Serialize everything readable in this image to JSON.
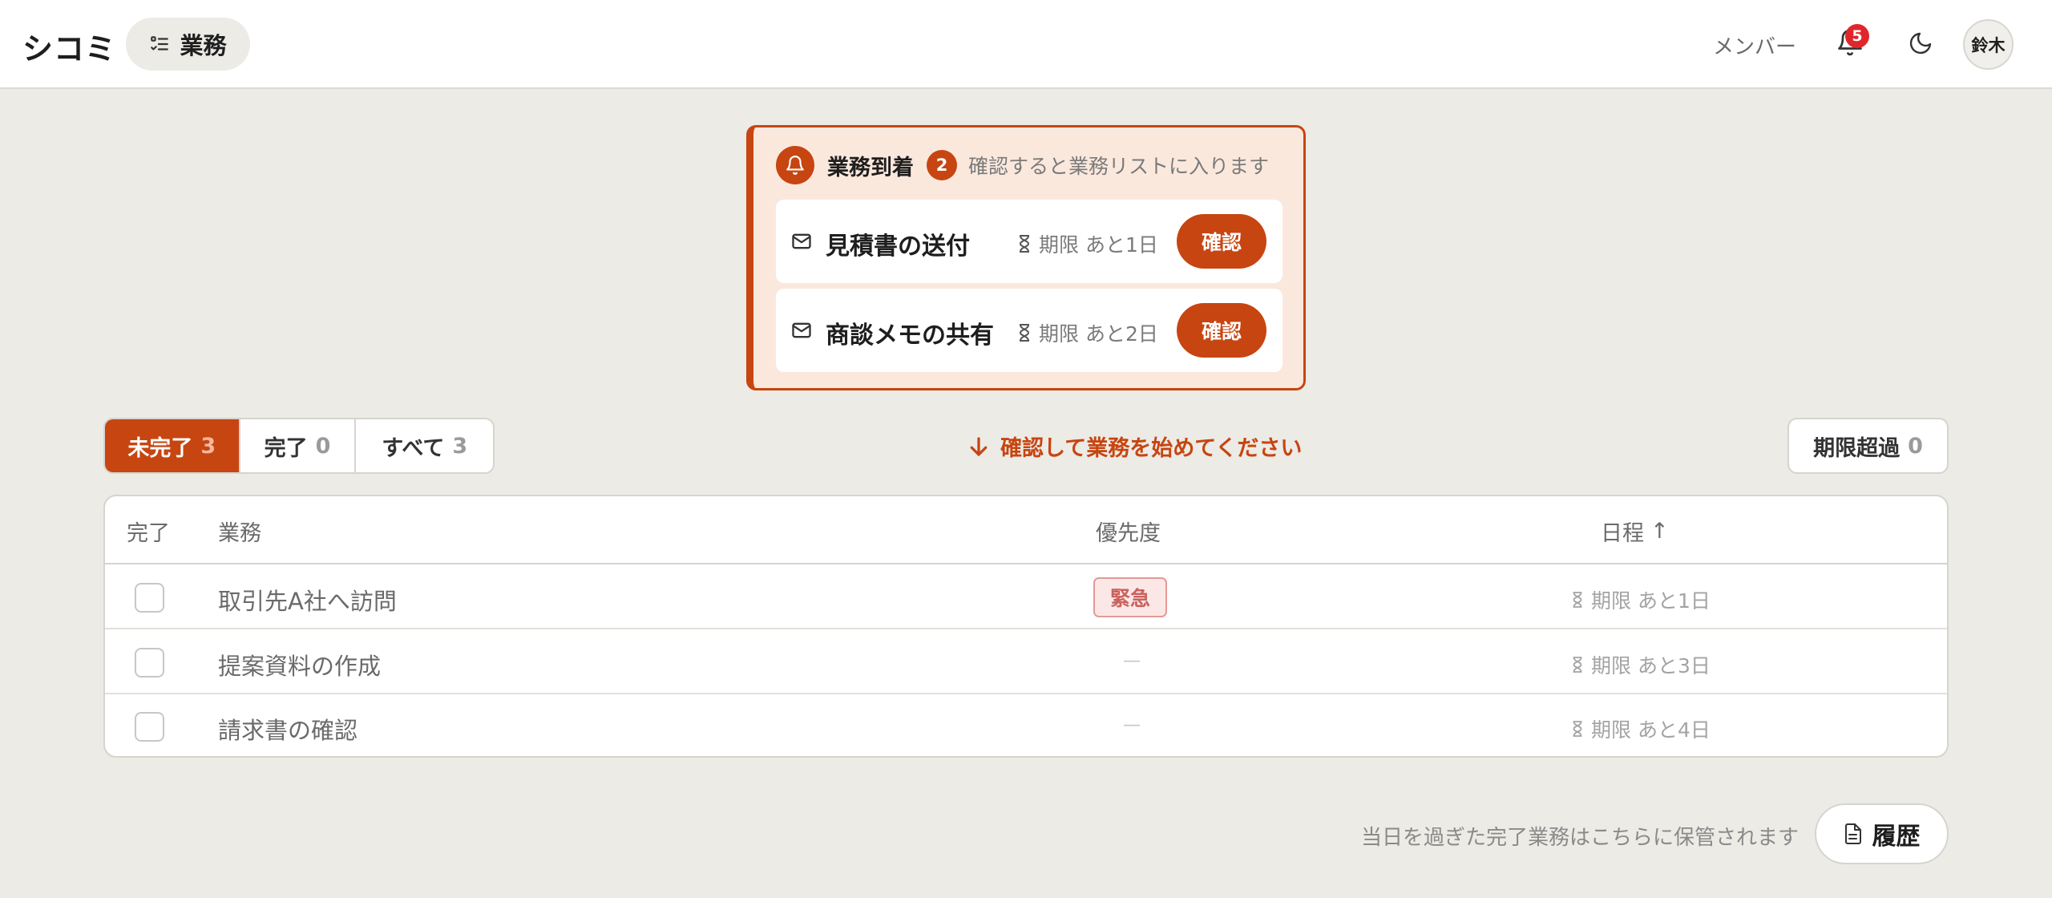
{
  "header": {
    "brand": "シコミ",
    "nav_label": "業務",
    "members_link": "メンバー",
    "notification_count": "5",
    "avatar_name": "鈴木"
  },
  "notice": {
    "title": "業務到着",
    "count": "2",
    "hint": "確認すると業務リストに入ります",
    "items": [
      {
        "title": "見積書の送付",
        "due": "期限 あと1日",
        "button": "確認"
      },
      {
        "title": "商談メモの共有",
        "due": "期限 あと2日",
        "button": "確認"
      }
    ]
  },
  "filters": {
    "tabs": [
      {
        "label": "未完了",
        "count": "3",
        "active": true
      },
      {
        "label": "完了",
        "count": "0",
        "active": false
      },
      {
        "label": "すべて",
        "count": "3",
        "active": false
      }
    ],
    "guide": "確認して業務を始めてください",
    "overdue_label": "期限超過",
    "overdue_count": "0"
  },
  "table": {
    "headers": {
      "done": "完了",
      "task": "業務",
      "priority": "優先度",
      "schedule": "日程",
      "sort_indicator": "↑"
    },
    "rows": [
      {
        "task": "取引先A社へ訪問",
        "priority": "緊急",
        "due": "期限 あと1日"
      },
      {
        "task": "提案資料の作成",
        "priority": "—",
        "due": "期限 あと3日"
      },
      {
        "task": "請求書の確認",
        "priority": "—",
        "due": "期限 あと4日"
      }
    ]
  },
  "footer": {
    "note": "当日を過ぎた完了業務はこちらに保管されます",
    "history_button": "履歴"
  },
  "colors": {
    "accent": "#c74511",
    "background": "#ecebe6",
    "notice_bg": "#fbe8dd",
    "urgent_text": "#c9625d",
    "badge_red": "#e0262a"
  },
  "icons": {
    "nav": "task-list-icon",
    "bell": "bell-icon",
    "moon": "moon-icon",
    "mail": "mail-icon",
    "hourglass": "hourglass-icon",
    "arrow": "arrow-down-icon",
    "document": "document-icon"
  }
}
